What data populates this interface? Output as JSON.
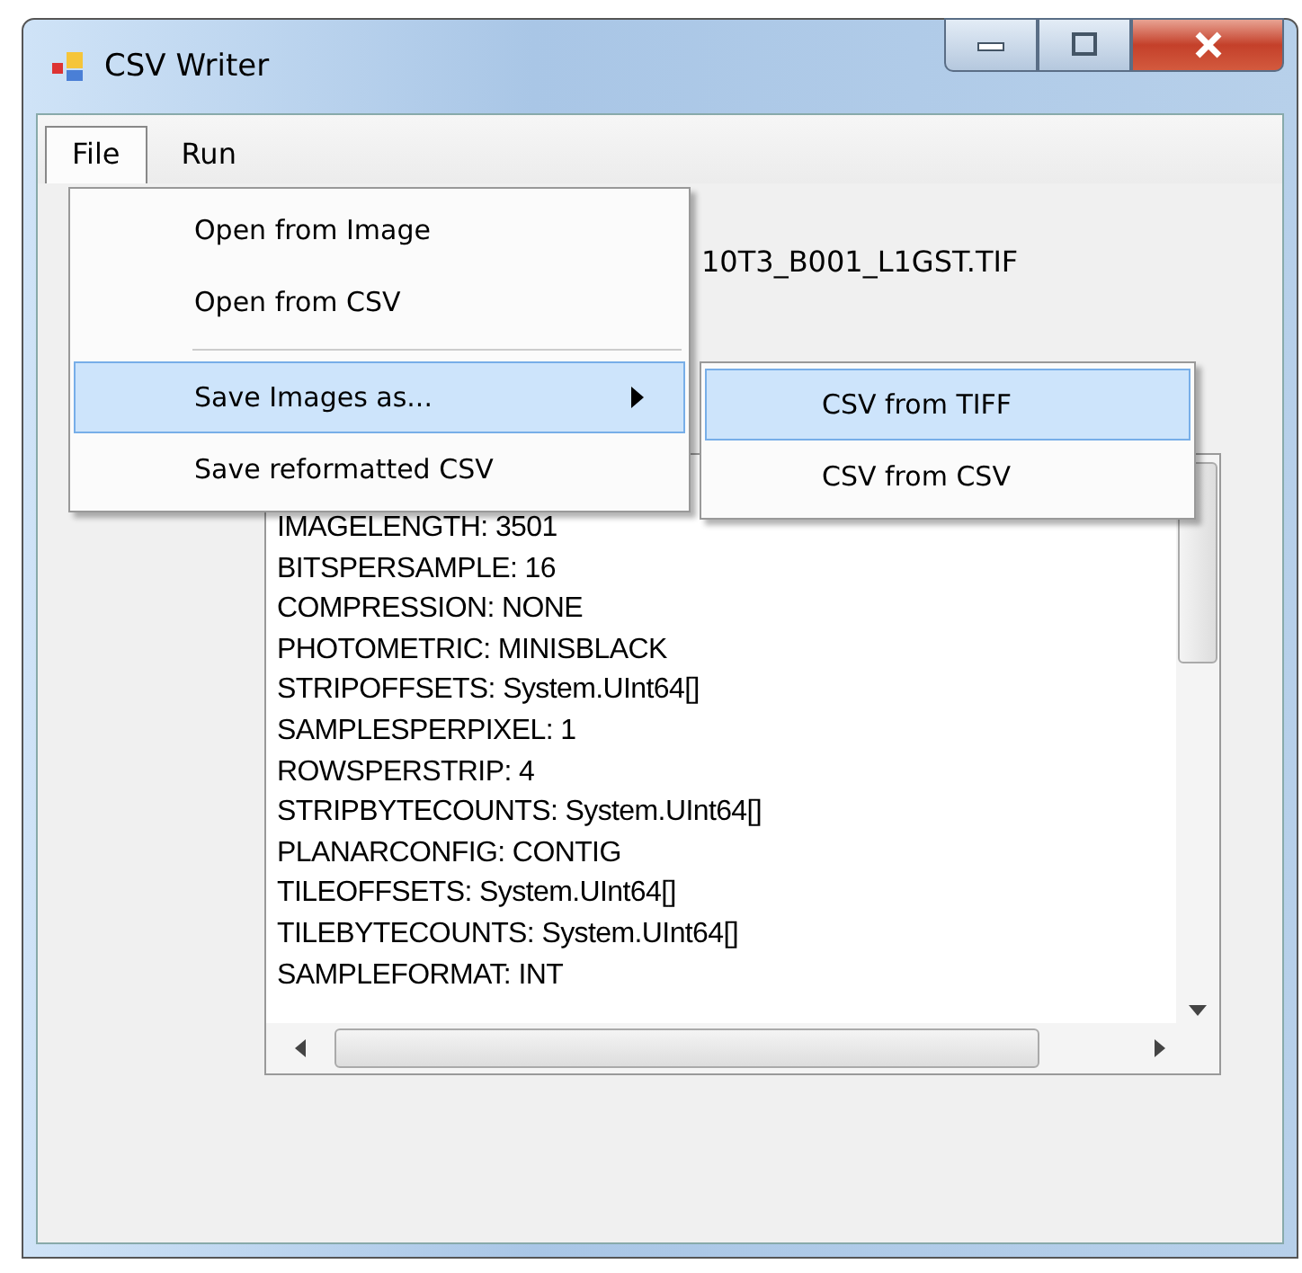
{
  "window": {
    "title": "CSV Writer"
  },
  "menubar": [
    {
      "label": "File",
      "selected": true
    },
    {
      "label": "Run",
      "selected": false
    }
  ],
  "file_label": "10T3_B001_L1GST.TIF",
  "file_menu": [
    {
      "kind": "item",
      "label": "Open from Image",
      "selected": false,
      "submenu": false
    },
    {
      "kind": "item",
      "label": "Open from CSV",
      "selected": false,
      "submenu": false
    },
    {
      "kind": "separator"
    },
    {
      "kind": "item",
      "label": "Save Images as...",
      "selected": true,
      "submenu": true
    },
    {
      "kind": "item",
      "label": "Save reformatted CSV",
      "selected": false,
      "submenu": false
    }
  ],
  "submenu": [
    {
      "label": "CSV from TIFF",
      "selected": true
    },
    {
      "label": "CSV from CSV",
      "selected": false
    }
  ],
  "tags_text": [
    "IMAGELENGTH: 3501",
    "BITSPERSAMPLE: 16",
    "COMPRESSION: NONE",
    "PHOTOMETRIC: MINISBLACK",
    "STRIPOFFSETS: System.UInt64[]",
    "SAMPLESPERPIXEL: 1",
    "ROWSPERSTRIP: 4",
    "STRIPBYTECOUNTS: System.UInt64[]",
    "PLANARCONFIG: CONTIG",
    "TILEOFFSETS: System.UInt64[]",
    "TILEBYTECOUNTS: System.UInt64[]",
    "SAMPLEFORMAT: INT"
  ]
}
